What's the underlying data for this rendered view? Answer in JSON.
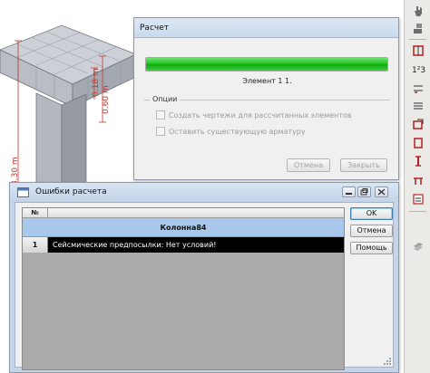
{
  "canvas": {
    "dim_width_label": "0.60 m",
    "dim_top_label": "0.18 m",
    "dim_height_label": "3.30 m",
    "dim_color": "#c0392b"
  },
  "progress_dialog": {
    "title": "Расчет",
    "progress": 1.0,
    "progress_color": "#22c322",
    "status_text": "Элемент 1 1.",
    "options_legend": "Опции",
    "options": [
      {
        "label": "Создать чертежи для рассчитанных элементов",
        "checked": false
      },
      {
        "label": "Оставить существующую арматуру",
        "checked": false
      }
    ],
    "cancel_label": "Отмена",
    "close_label": "Закрыть"
  },
  "errors_window": {
    "title": "Ошибки расчета",
    "column_number": "№",
    "group_title": "Колонна84",
    "rows": [
      {
        "number": "1",
        "text": "Сейсмические предпосылки: Нет условий!"
      }
    ],
    "ok_label": "OK",
    "cancel_label": "Отмена",
    "help_label": "Помощь"
  },
  "toolbar": {
    "icons": [
      "pointer-hand-icon",
      "robot-arm-icon",
      "rebar-frame-icon",
      "numbering-icon",
      "dimension-icon",
      "elevation-icon",
      "section-view-icon",
      "stirrup-icon",
      "column-rebar-icon",
      "beam-rebar-icon",
      "drawing-icon",
      "layers-icon"
    ]
  }
}
